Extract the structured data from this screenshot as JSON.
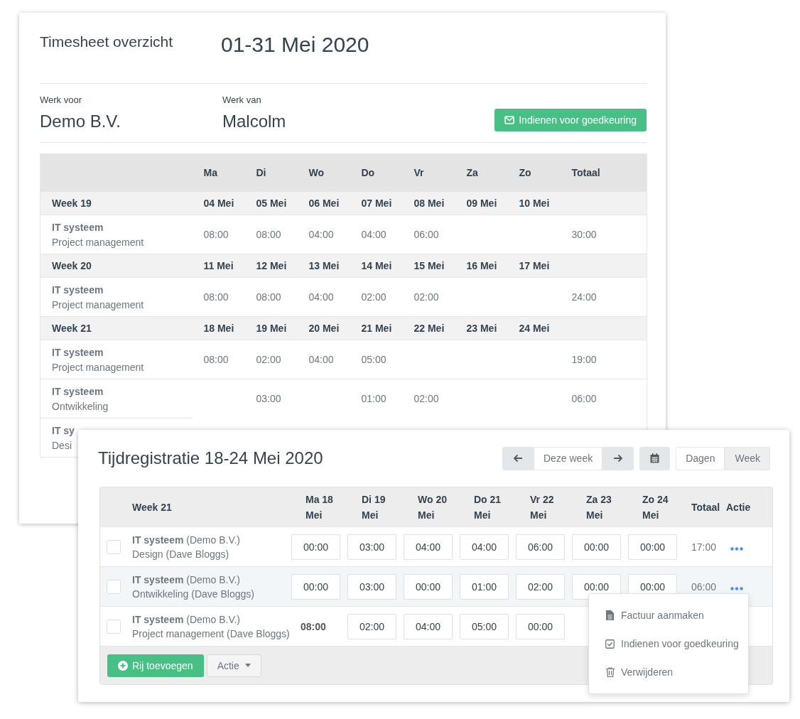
{
  "overview": {
    "title": "Timesheet overzicht",
    "period": "01-31 Mei 2020",
    "work_for": {
      "label": "Werk voor",
      "value": "Demo B.V."
    },
    "work_by": {
      "label": "Werk van",
      "value": "Malcolm"
    },
    "submit_button": "Indienen voor goedkeuring",
    "table": {
      "columns": [
        "Ma",
        "Di",
        "Wo",
        "Do",
        "Vr",
        "Za",
        "Zo",
        "Totaal"
      ],
      "rows": [
        {
          "kind": "week",
          "label": "Week 19",
          "cells": [
            "04 Mei",
            "05 Mei",
            "06 Mei",
            "07 Mei",
            "08 Mei",
            "09 Mei",
            "10 Mei",
            null
          ]
        },
        {
          "kind": "entry",
          "project": "IT systeem",
          "task": "Project management",
          "cells": [
            "08:00",
            "08:00",
            "04:00",
            "04:00",
            "06:00",
            null,
            null,
            "30:00"
          ]
        },
        {
          "kind": "week",
          "label": "Week 20",
          "cells": [
            "11 Mei",
            "12 Mei",
            "13 Mei",
            "14 Mei",
            "15 Mei",
            "16 Mei",
            "17 Mei",
            null
          ]
        },
        {
          "kind": "entry",
          "project": "IT systeem",
          "task": "Project management",
          "cells": [
            "08:00",
            "08:00",
            "04:00",
            "02:00",
            "02:00",
            null,
            null,
            "24:00"
          ]
        },
        {
          "kind": "week",
          "label": "Week 21",
          "cells": [
            "18 Mei",
            "19 Mei",
            "20 Mei",
            "21 Mei",
            "22 Mei",
            "23 Mei",
            "24 Mei",
            null
          ]
        },
        {
          "kind": "entry",
          "project": "IT systeem",
          "task": "Project management",
          "cells": [
            "08:00",
            "02:00",
            "04:00",
            "05:00",
            null,
            null,
            null,
            "19:00"
          ]
        },
        {
          "kind": "entry",
          "project": "IT systeem",
          "task": "Ontwikkeling",
          "cells": [
            null,
            "03:00",
            null,
            "01:00",
            "02:00",
            null,
            null,
            "06:00"
          ]
        },
        {
          "kind": "entry",
          "project": "IT sy",
          "task": "Desi",
          "cells": []
        }
      ]
    }
  },
  "week_card": {
    "title": "Tijdregistratie 18-24 Mei 2020",
    "current_week": "Deze week",
    "views": [
      {
        "label": "Dagen",
        "selected": false
      },
      {
        "label": "Week",
        "selected": true
      }
    ],
    "table": {
      "week_label": "Week 21",
      "columns": [
        "Ma 18 Mei",
        "Di 19 Mei",
        "Wo 20 Mei",
        "Do 21 Mei",
        "Vr 22 Mei",
        "Za 23 Mei",
        "Zo 24 Mei"
      ],
      "total_header": "Totaal",
      "action_header": "Actie",
      "rows": [
        {
          "checked": false,
          "highlighted": false,
          "menu_open": false,
          "project": "IT systeem",
          "client": "(Demo B.V.)",
          "task": "Design (Dave Bloggs)",
          "cells": [
            {
              "kind": "input",
              "value": "00:00"
            },
            {
              "kind": "input",
              "value": "03:00"
            },
            {
              "kind": "input",
              "value": "04:00"
            },
            {
              "kind": "input",
              "value": "04:00"
            },
            {
              "kind": "input",
              "value": "06:00"
            },
            {
              "kind": "input",
              "value": "00:00"
            },
            {
              "kind": "input",
              "value": "00:00"
            }
          ],
          "total": "17:00"
        },
        {
          "checked": false,
          "highlighted": true,
          "menu_open": true,
          "project": "IT systeem",
          "client": "(Demo B.V.)",
          "task": "Ontwikkeling (Dave Bloggs)",
          "cells": [
            {
              "kind": "input",
              "value": "00:00"
            },
            {
              "kind": "input",
              "value": "03:00"
            },
            {
              "kind": "input",
              "value": "00:00"
            },
            {
              "kind": "input",
              "value": "01:00"
            },
            {
              "kind": "input",
              "value": "02:00"
            },
            {
              "kind": "input",
              "value": "00:00"
            },
            {
              "kind": "input",
              "value": "00:00"
            }
          ],
          "total": "06:00"
        },
        {
          "checked": false,
          "highlighted": false,
          "menu_open": false,
          "project": "IT systeem",
          "client": "(Demo B.V.)",
          "task": "Project management (Dave Bloggs)",
          "cells": [
            {
              "kind": "text",
              "value": "08:00"
            },
            {
              "kind": "input",
              "value": "02:00"
            },
            {
              "kind": "input",
              "value": "04:00"
            },
            {
              "kind": "input",
              "value": "05:00"
            },
            {
              "kind": "input",
              "value": "00:00"
            }
          ]
        }
      ],
      "add_button": "Rij toevoegen",
      "action_button": "Actie"
    },
    "row_menu": {
      "items": [
        {
          "kind": "file",
          "label": "Factuur aanmaken"
        },
        {
          "kind": "check",
          "label": "Indienen voor goedkeuring"
        },
        {
          "kind": "trash",
          "label": "Verwijderen"
        }
      ]
    }
  }
}
